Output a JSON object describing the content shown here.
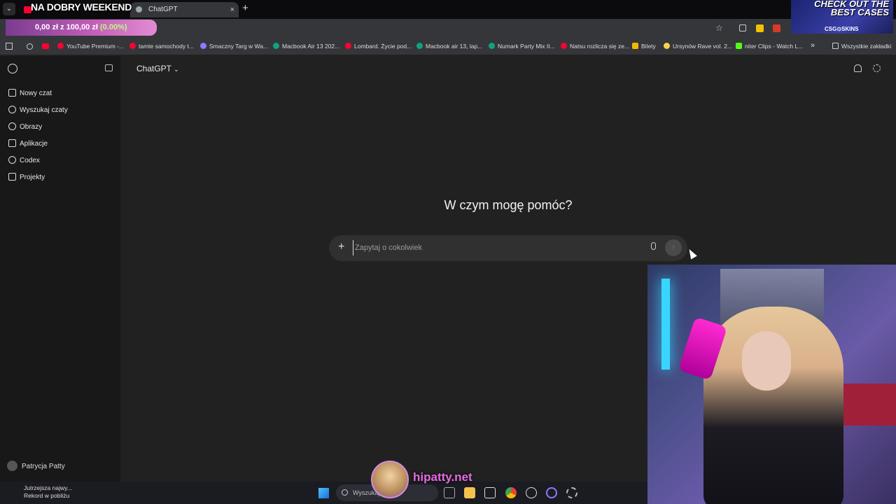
{
  "browser": {
    "stream_overlay_title": "NA DOBRY WEEKEND",
    "tabs": [
      {
        "label": ""
      },
      {
        "label": "ChatGPT",
        "close": "×"
      }
    ],
    "new_tab": "+",
    "donation": {
      "amount": "0,00 zł",
      "sep": "z",
      "goal": "100,00 zł",
      "percent": "(0.00%)",
      "progress_fraction": 0.0
    },
    "bookmarks": [
      {
        "label": "YouTube Premium -...",
        "color": "#ff0033"
      },
      {
        "label": "tamte samochody t...",
        "color": "#ff0033"
      },
      {
        "label": "Smaczny Targ w Wa...",
        "color": "#8a7cff"
      },
      {
        "label": "Macbook Air 13 202...",
        "color": "#10a37f"
      },
      {
        "label": "Lombard. Życie pod...",
        "color": "#ff0033"
      },
      {
        "label": "Macbook air 13, lap...",
        "color": "#10a37f"
      },
      {
        "label": "Numark Party Mix II...",
        "color": "#10a37f"
      },
      {
        "label": "Natsu rozlicza się ze...",
        "color": "#ff0033"
      },
      {
        "label": "Bilety",
        "color": "#f2b705"
      },
      {
        "label": "Ursynów Rave vol. 2...",
        "color": "#f7d34a"
      },
      {
        "label": "niter Clips - Watch L...",
        "color": "#53fc18"
      }
    ],
    "bookmarks_more": "»",
    "all_bookmarks": "Wszystkie zakładki"
  },
  "promo": {
    "text": "CHECK OUT THE BEST CASES",
    "brand": "CSG⊙SKINS"
  },
  "sidebar": {
    "items": [
      {
        "label": "Nowy czat",
        "icon": "edit-icon"
      },
      {
        "label": "Wyszukaj czaty",
        "icon": "search-icon"
      },
      {
        "label": "Obrazy",
        "icon": "image-icon"
      },
      {
        "label": "Aplikacje",
        "icon": "apps-icon"
      },
      {
        "label": "Codex",
        "icon": "codex-icon"
      },
      {
        "label": "Projekty",
        "icon": "folder-icon"
      }
    ],
    "user": "Patrycja Patty"
  },
  "main": {
    "model": "ChatGPT",
    "hero": "W czym mogę pomóc?",
    "composer": {
      "placeholder": "Zapytaj o cokolwiek",
      "value": ""
    }
  },
  "taskbar": {
    "news_title": "Jutrzejsza najwy...",
    "news_sub": "Rekord w pobliżu",
    "search": "Wyszukaj"
  },
  "overlay": {
    "site": "hipatty.net"
  }
}
